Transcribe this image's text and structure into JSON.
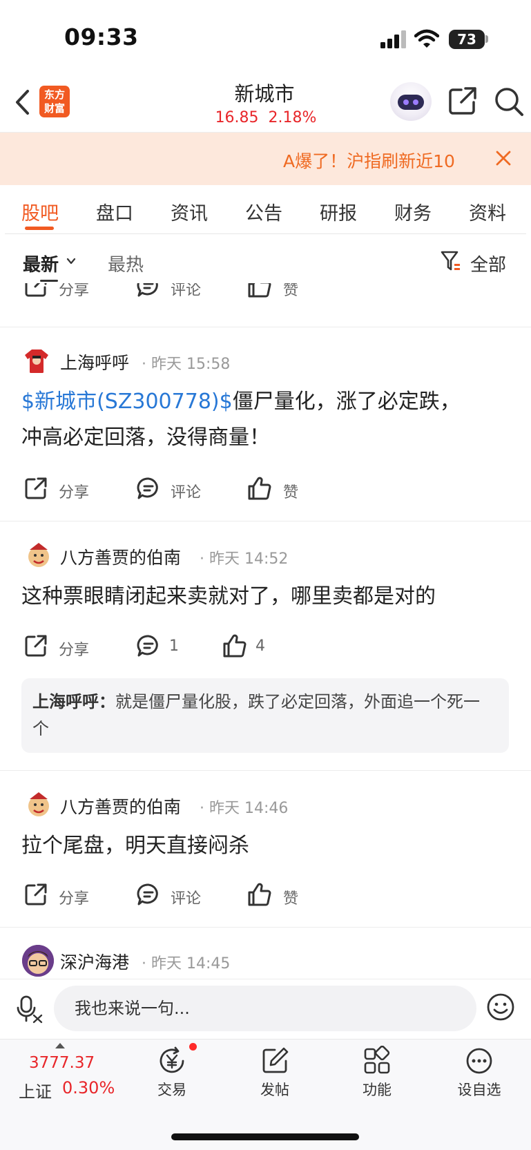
{
  "status": {
    "time": "09:33",
    "battery": "73"
  },
  "header": {
    "logo_line1": "东方",
    "logo_line2": "财富",
    "stock_name": "新城市",
    "stock_price": "16.85",
    "stock_change": "2.18%"
  },
  "banner": {
    "text": "A爆了！沪指刷新近10"
  },
  "tabs": [
    {
      "label": "股吧",
      "active": true
    },
    {
      "label": "盘口"
    },
    {
      "label": "资讯"
    },
    {
      "label": "公告"
    },
    {
      "label": "研报"
    },
    {
      "label": "财务"
    },
    {
      "label": "资料"
    }
  ],
  "filters": {
    "latest": "最新",
    "hot": "最热",
    "all": "全部"
  },
  "actions": {
    "share": "分享",
    "comment": "评论",
    "like": "赞"
  },
  "posts": [
    {
      "author": "上海呼呼",
      "time": "· 昨天 15:58",
      "stock_link": "$新城市(SZ300778)$",
      "body_line1": "僵尸量化，涨了必定跌，",
      "body_line2": "冲高必定回落，没得商量！",
      "comment": "评论",
      "like": "赞"
    },
    {
      "author": "八方善贾的伯南",
      "time": "· 昨天 14:52",
      "body_line1": "这种票眼睛闭起来卖就对了，哪里卖都是对的",
      "comment": "1",
      "like": "4",
      "reply": {
        "author": "上海呼呼：",
        "text": "就是僵尸量化股，跌了必定回落，外面追一个死一个"
      }
    },
    {
      "author": "八方善贾的伯南",
      "time": "· 昨天 14:46",
      "body_line1": "拉个尾盘，明天直接闷杀",
      "comment": "评论",
      "like": "赞"
    },
    {
      "author": "深沪海港",
      "time": "· 昨天 14:45"
    }
  ],
  "composer": {
    "placeholder": "我也来说一句..."
  },
  "bottom_bar": {
    "index_value": "3777.37",
    "index_name": "上证",
    "index_change": "0.30%",
    "nav": [
      {
        "label": "交易",
        "icon": "trade-yen-icon"
      },
      {
        "label": "发帖",
        "icon": "compose-icon"
      },
      {
        "label": "功能",
        "icon": "grid-icon"
      },
      {
        "label": "设自选",
        "icon": "more-icon"
      }
    ]
  },
  "colors": {
    "accent": "#f15a22",
    "up_red": "#e8262a",
    "link_blue": "#2878d6",
    "banner_bg": "#fde8dc"
  }
}
